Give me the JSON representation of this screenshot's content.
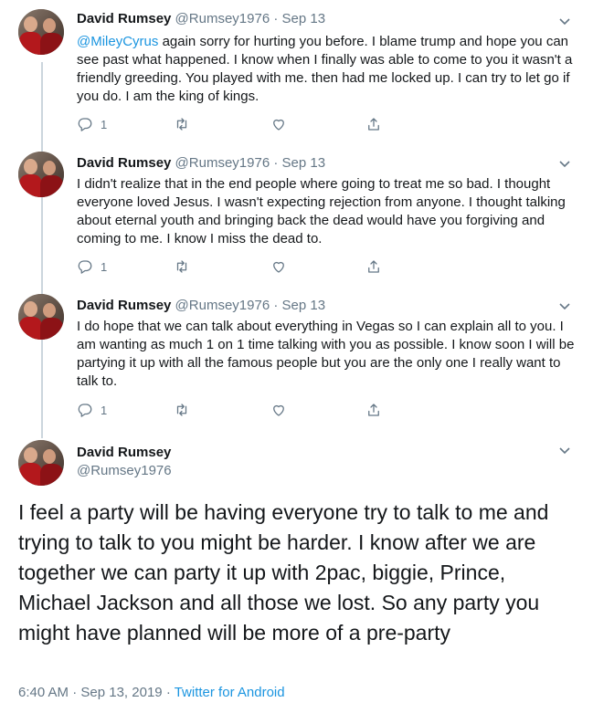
{
  "thread": [
    {
      "name": "David Rumsey",
      "handle": "@Rumsey1976",
      "sep": "·",
      "date": "Sep 13",
      "mention": "@MileyCyrus",
      "text": " again sorry for hurting you before. I blame trump and hope you can see past what happened. I know when I finally was able to come to you it wasn't a friendly greeding. You played with me. then had me locked up. I can try to let go if you do. I am the king of kings.",
      "reply_count": "1"
    },
    {
      "name": "David Rumsey",
      "handle": "@Rumsey1976",
      "sep": "·",
      "date": "Sep 13",
      "mention": "",
      "text": "I didn't realize that in the end people where going to treat me so bad. I thought everyone loved Jesus. I wasn't expecting rejection from anyone. I thought talking about eternal youth and bringing back the dead would have you forgiving and coming to me. I know I miss the dead to.",
      "reply_count": "1"
    },
    {
      "name": "David Rumsey",
      "handle": "@Rumsey1976",
      "sep": "·",
      "date": "Sep 13",
      "mention": "",
      "text": "I do hope that we can talk about everything in Vegas so I can explain all to you. I am wanting as much 1 on 1 time talking with you as possible. I know soon I will be partying it up with all the famous people but you are the only one I really want to talk to.",
      "reply_count": "1"
    }
  ],
  "main_tweet": {
    "name": "David Rumsey",
    "handle": "@Rumsey1976",
    "text": "I feel a party will be having everyone try to talk to me and trying to talk to you might be harder. I know after we are together we can party it up with 2pac, biggie, Prince, Michael Jackson and all those we lost. So any party you might have planned will be more of a pre-party",
    "time": "6:40 AM",
    "sep": "·",
    "full_date": "Sep 13, 2019",
    "source": "Twitter for Android"
  },
  "icons": {
    "reply": "reply-icon",
    "retweet": "retweet-icon",
    "like": "like-icon",
    "share": "share-icon",
    "more": "chevron-down-icon"
  },
  "colors": {
    "link": "#1b95e0",
    "muted": "#657786",
    "thread_line": "#ccd6dd",
    "text": "#14171a"
  }
}
